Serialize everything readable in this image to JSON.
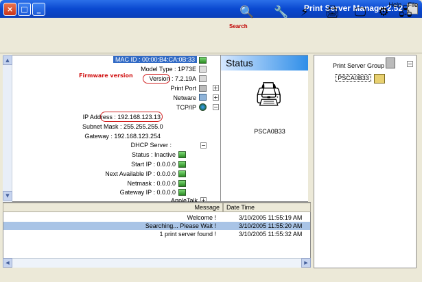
{
  "window": {
    "title": "Print Server Manager2.52",
    "close": "×",
    "maximize": "□",
    "minimize": "_"
  },
  "menu": {
    "file": "File",
    "help": "Help"
  },
  "toolbar": {
    "search_label": "Search"
  },
  "tree": {
    "group": "Print Server Group",
    "server": "PSCA0B33"
  },
  "status": {
    "header": "Status",
    "server_name": "PSCA0B33"
  },
  "info": {
    "mac": "MAC ID : 00:00:B4:CA:0B:33",
    "model": "Model Type : 1P73E",
    "version": "Version : 7.2.19A",
    "firmware_note": "Firmware version",
    "printport": "Print Port",
    "netware": "Netware",
    "tcpip": "TCP/IP",
    "ip": "IP Address : 192.168.123.13",
    "subnet": "Subnet Mask : 255.255.255.0",
    "gateway": "Gateway : 192.168.123.254",
    "dhcp": "DHCP Server :",
    "dhcp_status": "Status : Inactive",
    "start_ip": "Start IP : 0.0.0.0",
    "next_ip": "Next Available IP : 0.0.0.0",
    "netmask": "Netmask : 0.0.0.0",
    "gw_ip": "Gateway IP : 0.0.0.0",
    "appletalk": "AppleTalk"
  },
  "log": {
    "col_date": "Date Time",
    "col_msg": "Message",
    "rows": [
      {
        "date": "3/10/2005 11:55:19 AM",
        "msg": "Welcome !"
      },
      {
        "date": "3/10/2005 11:55:20 AM",
        "msg": "Searching... Please Wait !"
      },
      {
        "date": "3/10/2005 11:55:32 AM",
        "msg": "1 print server found !"
      }
    ]
  }
}
